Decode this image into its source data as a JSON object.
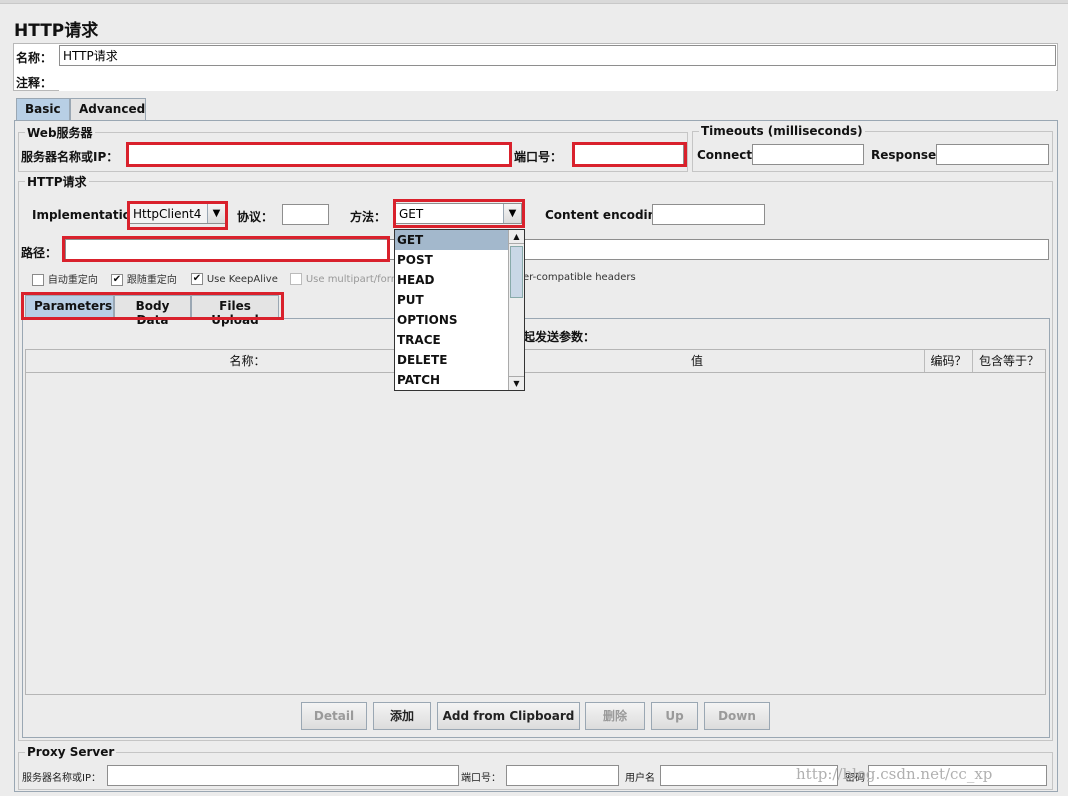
{
  "page_title": "HTTP请求",
  "name_label": "名称：",
  "name_value": "HTTP请求",
  "comment_label": "注释：",
  "tabs": [
    "Basic",
    "Advanced"
  ],
  "web_server": {
    "legend": "Web服务器",
    "server_label": "服务器名称或IP：",
    "port_label": "端口号："
  },
  "timeouts": {
    "legend": "Timeouts (milliseconds)",
    "connect_label": "Connect:",
    "response_label": "Response:"
  },
  "http_request": {
    "legend": "HTTP请求",
    "implementation_label": "Implementation:",
    "implementation_value": "HttpClient4",
    "protocol_label": "协议：",
    "method_label": "方法：",
    "method_value": "GET",
    "encoding_label": "Content encoding:",
    "path_label": "路径："
  },
  "checkboxes": [
    {
      "label": "自动重定向",
      "checked": false
    },
    {
      "label": "跟随重定向",
      "checked": true
    },
    {
      "label": "Use KeepAlive",
      "checked": true
    },
    {
      "label": "Use multipart/form",
      "checked": false
    }
  ],
  "browser_headers_tail": "er-compatible headers",
  "sub_tabs": [
    "Parameters",
    "Body Data",
    "Files Upload"
  ],
  "send_params_fragment": "起发送参数：",
  "table_headers": [
    "名称：",
    "值",
    "编码？",
    "包含等于？"
  ],
  "method_options": [
    "GET",
    "POST",
    "HEAD",
    "PUT",
    "OPTIONS",
    "TRACE",
    "DELETE",
    "PATCH"
  ],
  "buttons": {
    "detail": "Detail",
    "add": "添加",
    "add_clipboard": "Add from Clipboard",
    "delete": "删除",
    "up": "Up",
    "down": "Down"
  },
  "proxy": {
    "legend": "Proxy Server",
    "server_label": "服务器名称或IP：",
    "port_label": "端口号：",
    "user_label": "用户名",
    "password_label": "密码"
  },
  "watermark": "http://blog.csdn.net/cc_xp"
}
